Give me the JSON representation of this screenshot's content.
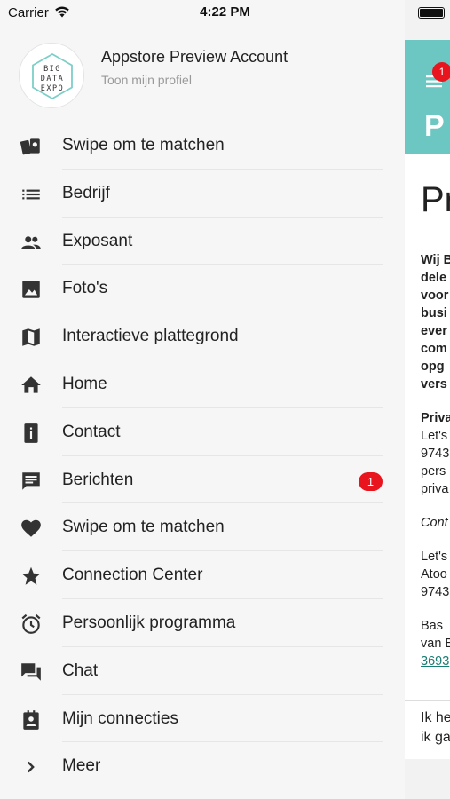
{
  "status_bar": {
    "carrier": "Carrier",
    "time": "4:22 PM",
    "battery_level": 1.0
  },
  "profile": {
    "logo_lines": [
      "BIG",
      "DATA",
      "EXPO"
    ],
    "name": "Appstore Preview Account",
    "link": "Toon mijn profiel"
  },
  "menu": {
    "items": [
      {
        "label": "Swipe om te matchen",
        "icon": "swipe-cards-icon"
      },
      {
        "label": "Bedrijf",
        "icon": "list-icon"
      },
      {
        "label": "Exposant",
        "icon": "people-icon"
      },
      {
        "label": "Foto's",
        "icon": "photo-icon"
      },
      {
        "label": "Interactieve plattegrond",
        "icon": "map-icon"
      },
      {
        "label": "Home",
        "icon": "home-icon"
      },
      {
        "label": "Contact",
        "icon": "contact-info-icon"
      },
      {
        "label": "Berichten",
        "icon": "message-icon",
        "badge": "1"
      },
      {
        "label": "Swipe om te matchen",
        "icon": "heart-icon"
      },
      {
        "label": "Connection Center",
        "icon": "star-icon"
      },
      {
        "label": "Persoonlijk programma",
        "icon": "alarm-clock-icon"
      },
      {
        "label": "Chat",
        "icon": "chat-icon"
      },
      {
        "label": "Mijn connecties",
        "icon": "contact-badge-icon"
      },
      {
        "label": "Meer",
        "icon": "chevron-right-icon"
      }
    ]
  },
  "background_page": {
    "header_badge": "1",
    "header_title": "P",
    "title": "Pr",
    "bold_lines": [
      "Wij B",
      "dele",
      "voor",
      "busi",
      "ever",
      "com",
      "opg",
      "vers"
    ],
    "privacy_heading": "Priva",
    "privacy_lines": [
      "Let's",
      "9743",
      "pers",
      "priva"
    ],
    "italic_line": "Cont",
    "address_lines": [
      "Let's",
      "Atoo",
      "9743"
    ],
    "contact_lines": [
      "Bas ",
      "van B"
    ],
    "phone_link": "3693",
    "footer_lines": [
      "Ik he",
      "ik ga"
    ]
  },
  "colors": {
    "accent_teal": "#6cc7c2",
    "badge_red": "#e8141e",
    "logo_teal": "#7ccfc8"
  }
}
